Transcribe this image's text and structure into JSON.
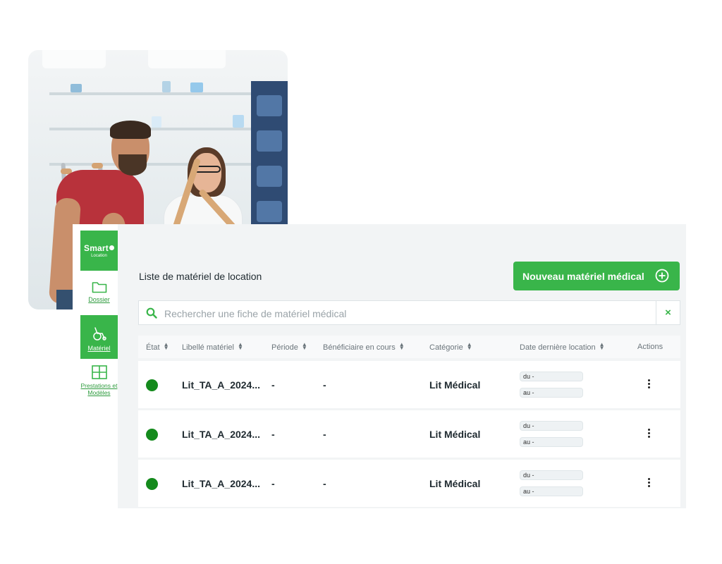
{
  "sidebar": {
    "logo": {
      "line1": "Smart",
      "line2": "Location"
    },
    "items": [
      {
        "label": "Dossier",
        "icon": "folder-icon",
        "active": false
      },
      {
        "label": "Matériel",
        "icon": "wheelchair-icon",
        "active": true
      },
      {
        "label": "Prestations et Modèles",
        "icon": "layout-grid-icon",
        "active": false
      }
    ]
  },
  "header": {
    "title": "Liste de matériel de location",
    "new_button": "Nouveau matériel médical"
  },
  "search": {
    "placeholder": "Rechercher une fiche de matériel médical",
    "clear": "×"
  },
  "table": {
    "columns": [
      "État",
      "Libellé matériel",
      "Période",
      "Bénéficiaire en cours",
      "Catégorie",
      "Date dernière location",
      "Actions"
    ],
    "rows": [
      {
        "status": "active",
        "label": "Lit_TA_A_2024...",
        "period": "-",
        "beneficiary": "-",
        "category": "Lit Médical",
        "date_from": "du  -",
        "date_to": "au  -"
      },
      {
        "status": "active",
        "label": "Lit_TA_A_2024...",
        "period": "-",
        "beneficiary": "-",
        "category": "Lit Médical",
        "date_from": "du  -",
        "date_to": "au  -"
      },
      {
        "status": "active",
        "label": "Lit_TA_A_2024...",
        "period": "-",
        "beneficiary": "-",
        "category": "Lit Médical",
        "date_from": "du  -",
        "date_to": "au  -"
      }
    ]
  },
  "colors": {
    "accent": "#39b54a",
    "status_active": "#148a1c",
    "background": "#f2f4f5"
  }
}
